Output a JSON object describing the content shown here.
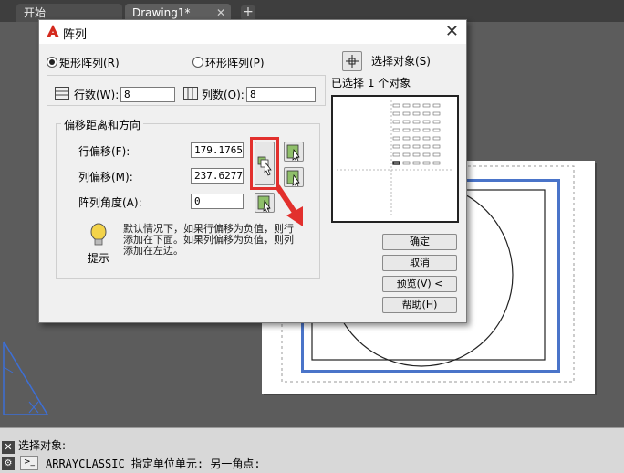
{
  "tabs": [
    {
      "label": "开始"
    },
    {
      "label": "Drawing1*"
    }
  ],
  "tab_close_glyph": "✕",
  "tab_add_glyph": "+",
  "dialog": {
    "title": "阵列",
    "close_glyph": "✕",
    "rect_array_label": "矩形阵列(R)",
    "polar_array_label": "环形阵列(P)",
    "rows_label": "行数(W):",
    "rows_value": "8",
    "cols_label": "列数(O):",
    "cols_value": "8",
    "offset_group_label": "偏移距离和方向",
    "row_offset_label": "行偏移(F):",
    "row_offset_value": "179.1765",
    "col_offset_label": "列偏移(M):",
    "col_offset_value": "237.6277",
    "angle_label": "阵列角度(A):",
    "angle_value": "0",
    "tip_label": "提示",
    "tip_text": "默认情况下，如果行偏移为负值，则行添加在下面。如果列偏移为负值，则列添加在左边。",
    "select_objects_label": "选择对象(S)",
    "selected_count_label": "已选择 1 个对象",
    "ok_label": "确定",
    "cancel_label": "取消",
    "preview_label": "预览(V) <",
    "help_label": "帮助(H)"
  },
  "command": {
    "line1": "选择对象:",
    "line2": "ARRAYCLASSIC 指定单位单元: 另一角点:"
  },
  "colors": {
    "highlight_red": "#e2302d",
    "highlight_blue": "#4a74c9",
    "logo_red": "#d42a1e"
  },
  "icons": [
    "autocad-logo-icon",
    "close-icon",
    "rows-grid-icon",
    "cols-grid-icon",
    "pick-point-icon",
    "lightbulb-icon",
    "select-objects-icon",
    "command-prompt-icon",
    "wrench-icon",
    "red-arrow-icon"
  ]
}
